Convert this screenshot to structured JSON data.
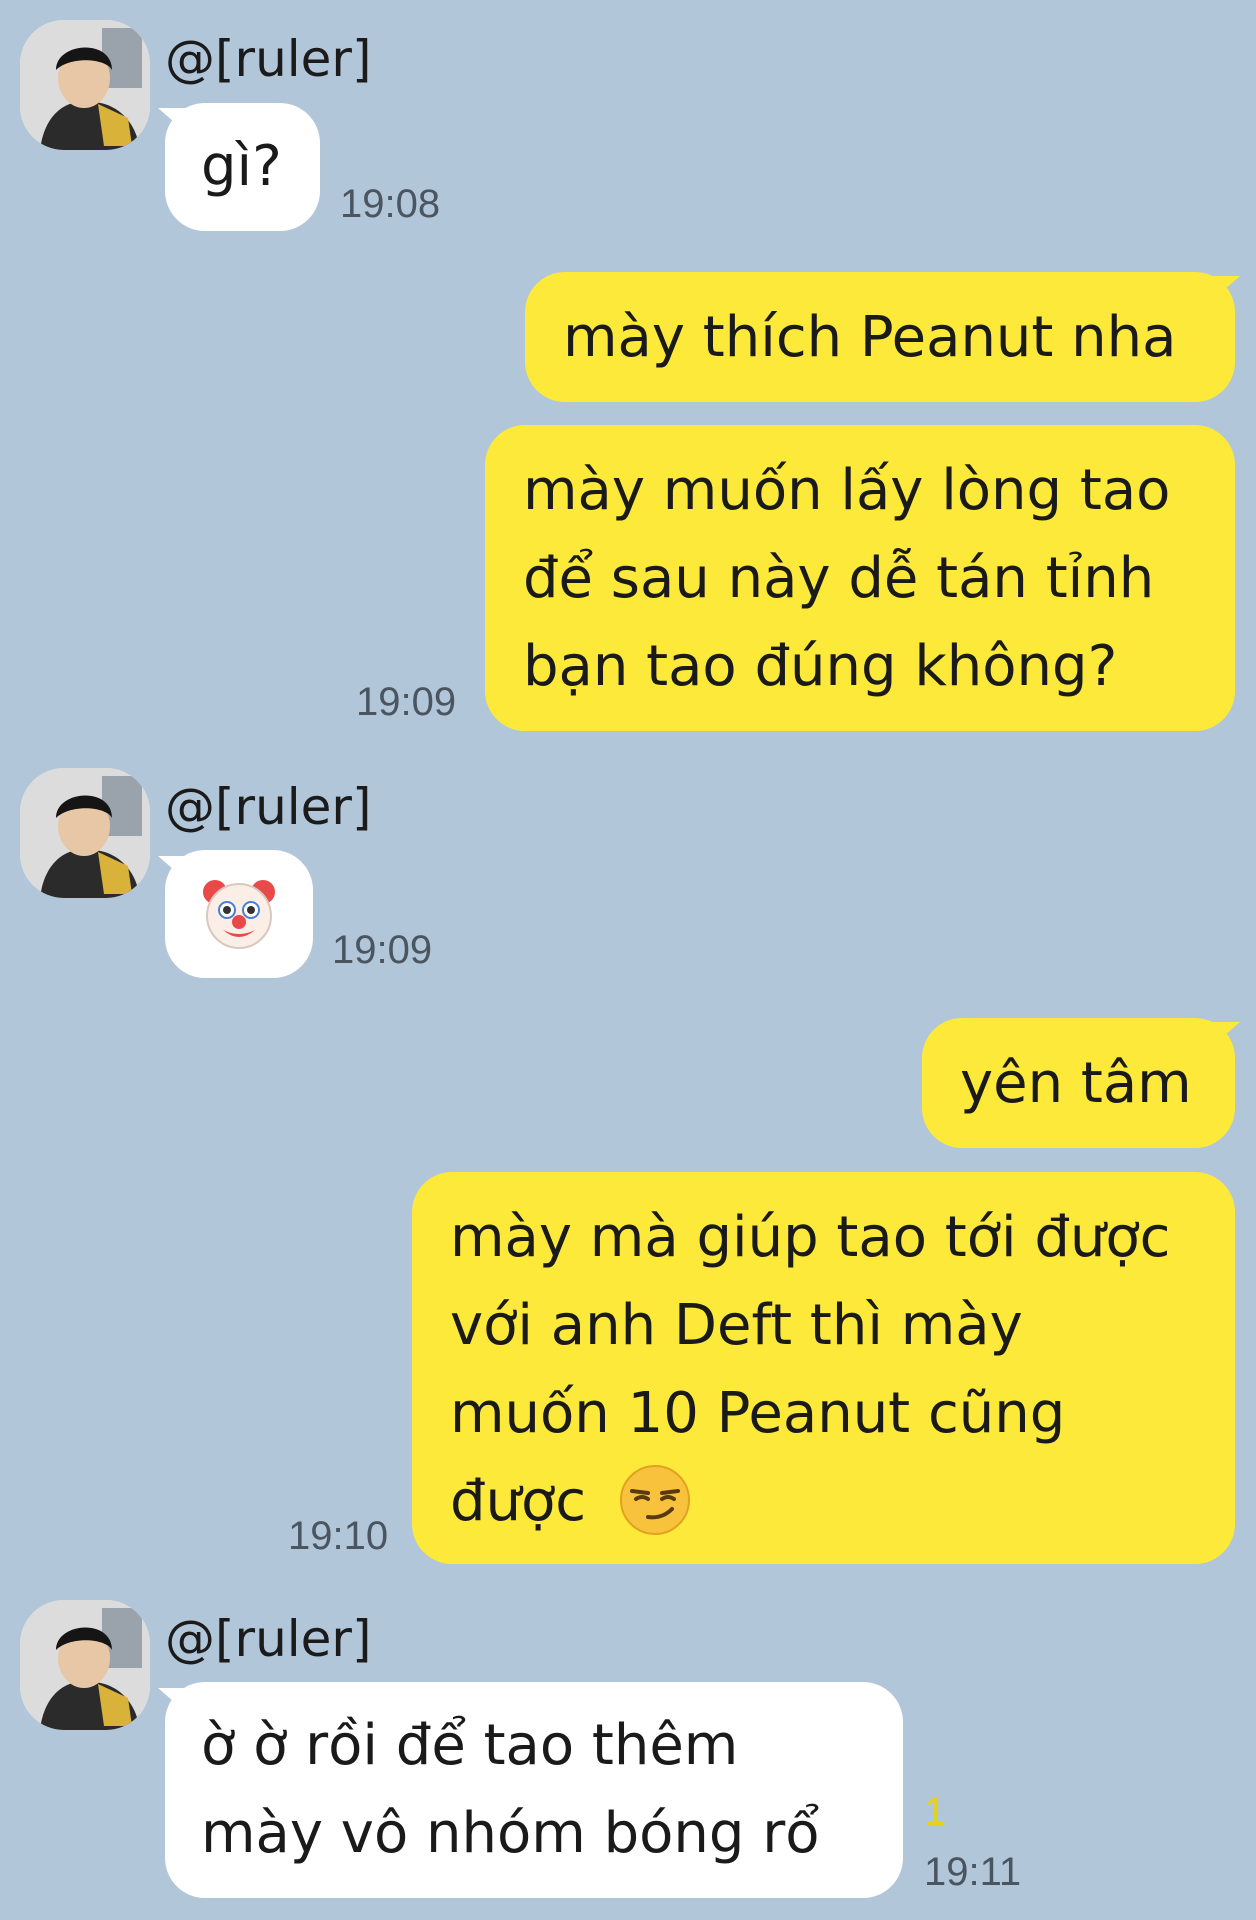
{
  "messages": [
    {
      "sender": "@[ruler]",
      "text": "gì?",
      "time": "19:08"
    },
    {
      "text": "mày thích Peanut nha"
    },
    {
      "lines": [
        "mày muốn lấy lòng tao",
        "để sau này dễ tán tỉnh",
        "bạn tao đúng không?"
      ],
      "time": "19:09"
    },
    {
      "sender": "@[ruler]",
      "emoji": "clown-face",
      "time": "19:09"
    },
    {
      "text": "yên tâm"
    },
    {
      "lines": [
        "mày mà giúp tao tới được",
        "với anh Deft thì mày",
        "muốn 10 Peanut cũng",
        "được"
      ],
      "trailing_emoji": "smirking-face",
      "time": "19:10"
    },
    {
      "sender": "@[ruler]",
      "lines": [
        "ờ ờ rồi để tao thêm",
        "mày vô nhóm bóng rổ"
      ],
      "unread": "1",
      "time": "19:11"
    }
  ],
  "colors": {
    "background": "#b2c6da",
    "incoming": "#ffffff",
    "outgoing": "#fde939"
  }
}
